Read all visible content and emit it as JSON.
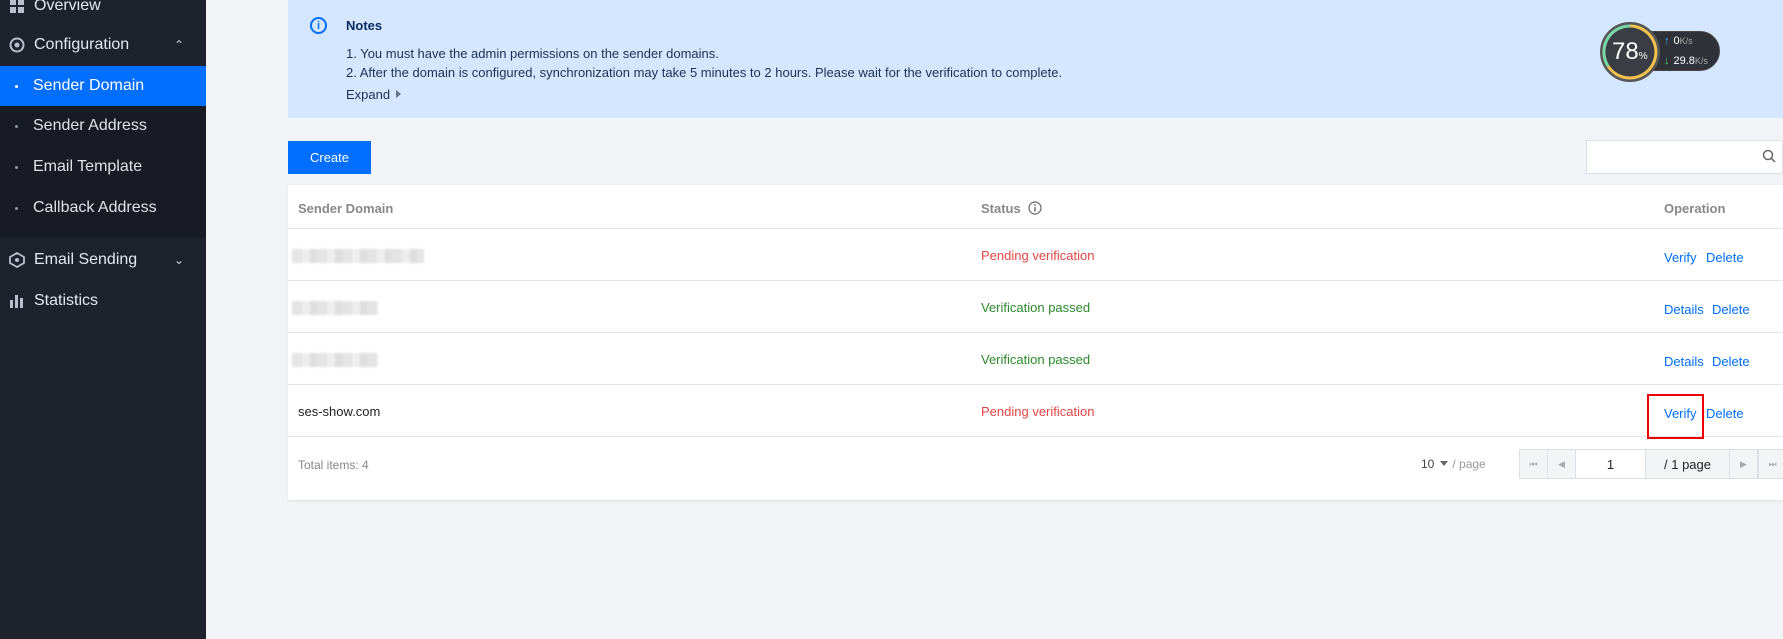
{
  "sidebar": {
    "overview": "Overview",
    "configuration": "Configuration",
    "sub_items": [
      "Sender Domain",
      "Sender Address",
      "Email Template",
      "Callback Address"
    ],
    "email_sending": "Email Sending",
    "statistics": "Statistics"
  },
  "notes": {
    "title": "Notes",
    "line1": "1. You must have the admin permissions on the sender domains.",
    "line2": "2. After the domain is configured, synchronization may take 5 minutes to 2 hours. Please wait for the verification to complete.",
    "expand": "Expand"
  },
  "widget": {
    "percent": "78",
    "percent_unit": "%",
    "upload": "0",
    "download": "29.8",
    "unit": "K/s"
  },
  "toolbar": {
    "create_label": "Create"
  },
  "table": {
    "headers": {
      "domain": "Sender Domain",
      "status": "Status",
      "operation": "Operation"
    },
    "rows": [
      {
        "domain": "",
        "status": "Pending verification",
        "op1": "Verify",
        "op2": "Delete"
      },
      {
        "domain": "",
        "status": "Verification passed",
        "op1": "Details",
        "op2": "Delete"
      },
      {
        "domain": "",
        "status": "Verification passed",
        "op1": "Details",
        "op2": "Delete"
      },
      {
        "domain": "ses-show.com",
        "status": "Pending verification",
        "op1": "Verify",
        "op2": "Delete"
      }
    ],
    "total_label": "Total items:",
    "total_count": "4"
  },
  "pagination": {
    "page_size": "10",
    "per_page": "/ page",
    "current_page": "1",
    "total_pages": "/ 1 page"
  },
  "colors": {
    "accent": "#006eff",
    "pending": "#e54545",
    "passed": "#2c8a2c",
    "sidebar_bg": "#1e222d"
  }
}
